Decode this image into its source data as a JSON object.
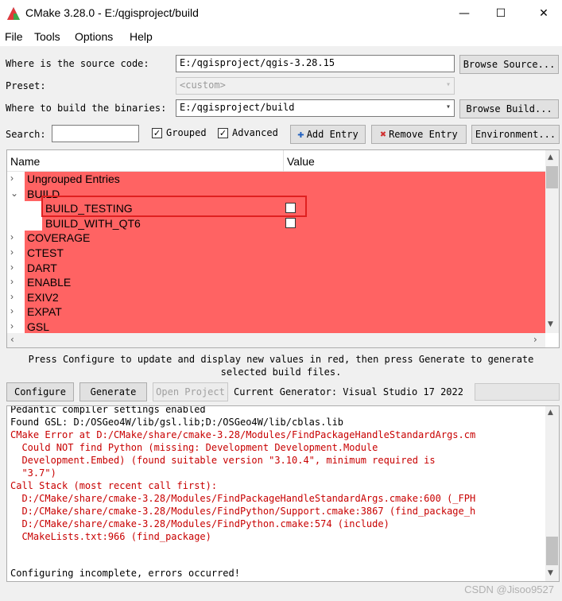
{
  "window": {
    "title": "CMake 3.28.0 - E:/qgisproject/build",
    "minimize": "—",
    "maximize": "☐",
    "close": "✕"
  },
  "menu": {
    "file": "File",
    "tools": "Tools",
    "options": "Options",
    "help": "Help"
  },
  "source": {
    "label": "Where is the source code:",
    "value": "E:/qgisproject/qgis-3.28.15",
    "browse": "Browse Source..."
  },
  "preset": {
    "label": "Preset:",
    "value": "<custom>"
  },
  "build_dir": {
    "label": "Where to build the binaries:",
    "value": "E:/qgisproject/build",
    "browse": "Browse Build..."
  },
  "toolbar": {
    "search_label": "Search:",
    "search_value": "",
    "grouped_label": "Grouped",
    "grouped_checked": true,
    "advanced_label": "Advanced",
    "advanced_checked": true,
    "add_entry": "Add Entry",
    "remove_entry": "Remove Entry",
    "environment": "Environment..."
  },
  "tree": {
    "col_name": "Name",
    "col_value": "Value",
    "rows": [
      {
        "label": "Ungrouped Entries",
        "arrow": "›"
      },
      {
        "label": "BUILD",
        "arrow": "⌄"
      },
      {
        "label": "BUILD_TESTING",
        "arrow": "",
        "checkbox": true
      },
      {
        "label": "BUILD_WITH_QT6",
        "arrow": "",
        "checkbox": true
      },
      {
        "label": "COVERAGE",
        "arrow": "›"
      },
      {
        "label": "CTEST",
        "arrow": "›"
      },
      {
        "label": "DART",
        "arrow": "›"
      },
      {
        "label": "ENABLE",
        "arrow": "›"
      },
      {
        "label": "EXIV2",
        "arrow": "›"
      },
      {
        "label": "EXPAT",
        "arrow": "›"
      },
      {
        "label": "GSL",
        "arrow": "›"
      }
    ],
    "row_color": "#ff6363"
  },
  "hint": {
    "line1": "Press Configure to update and display new values in red, then press Generate to generate",
    "line2": "selected build files."
  },
  "actions": {
    "configure": "Configure",
    "generate": "Generate",
    "open_project": "Open Project",
    "generator": "Current Generator: Visual Studio 17 2022"
  },
  "log": {
    "lines": [
      {
        "text": "Pedantic compiler settings enabled",
        "error": false
      },
      {
        "text": "Found GSL: D:/OSGeo4W/lib/gsl.lib;D:/OSGeo4W/lib/cblas.lib",
        "error": false
      },
      {
        "text": "CMake Error at D:/CMake/share/cmake-3.28/Modules/FindPackageHandleStandardArgs.cm",
        "error": true
      },
      {
        "text": "  Could NOT find Python (missing: Development Development.Module",
        "error": true
      },
      {
        "text": "  Development.Embed) (found suitable version \"3.10.4\", minimum required is",
        "error": true
      },
      {
        "text": "  \"3.7\")",
        "error": true
      },
      {
        "text": "Call Stack (most recent call first):",
        "error": true
      },
      {
        "text": "  D:/CMake/share/cmake-3.28/Modules/FindPackageHandleStandardArgs.cmake:600 (_FPH",
        "error": true
      },
      {
        "text": "  D:/CMake/share/cmake-3.28/Modules/FindPython/Support.cmake:3867 (find_package_h",
        "error": true
      },
      {
        "text": "  D:/CMake/share/cmake-3.28/Modules/FindPython.cmake:574 (include)",
        "error": true
      },
      {
        "text": "  CMakeLists.txt:966 (find_package)",
        "error": true
      }
    ],
    "final": "Configuring incomplete, errors occurred!"
  },
  "watermark": "CSDN @Jisoo9527"
}
